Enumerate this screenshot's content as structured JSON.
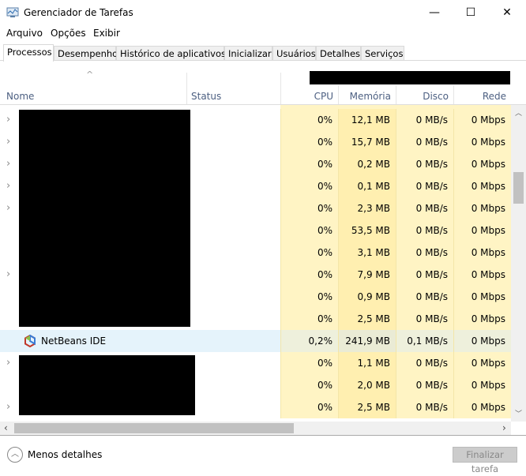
{
  "window": {
    "title": "Gerenciador de Tarefas",
    "minimize": "—",
    "maximize": "☐",
    "close": "✕"
  },
  "menu": [
    "Arquivo",
    "Opções",
    "Exibir"
  ],
  "tabs": [
    "Processos",
    "Desempenho",
    "Histórico de aplicativos",
    "Inicializar",
    "Usuários",
    "Detalhes",
    "Serviços"
  ],
  "columns": {
    "name": "Nome",
    "status": "Status",
    "cpu": "CPU",
    "memory": "Memória",
    "disk": "Disco",
    "network": "Rede"
  },
  "rows": [
    {
      "expand": true,
      "name": "",
      "cpu": "0%",
      "mem": "12,1 MB",
      "disk": "0 MB/s",
      "net": "0 Mbps"
    },
    {
      "expand": true,
      "name": "",
      "cpu": "0%",
      "mem": "15,7 MB",
      "disk": "0 MB/s",
      "net": "0 Mbps"
    },
    {
      "expand": true,
      "name": "",
      "cpu": "0%",
      "mem": "0,2 MB",
      "disk": "0 MB/s",
      "net": "0 Mbps"
    },
    {
      "expand": true,
      "name": "",
      "cpu": "0%",
      "mem": "0,1 MB",
      "disk": "0 MB/s",
      "net": "0 Mbps"
    },
    {
      "expand": true,
      "name": "",
      "cpu": "0%",
      "mem": "2,3 MB",
      "disk": "0 MB/s",
      "net": "0 Mbps"
    },
    {
      "expand": false,
      "name": "",
      "cpu": "0%",
      "mem": "53,5 MB",
      "disk": "0 MB/s",
      "net": "0 Mbps"
    },
    {
      "expand": false,
      "name": "",
      "cpu": "0%",
      "mem": "3,1 MB",
      "disk": "0 MB/s",
      "net": "0 Mbps"
    },
    {
      "expand": true,
      "name": "",
      "cpu": "0%",
      "mem": "7,9 MB",
      "disk": "0 MB/s",
      "net": "0 Mbps"
    },
    {
      "expand": false,
      "name": "",
      "cpu": "0%",
      "mem": "0,9 MB",
      "disk": "0 MB/s",
      "net": "0 Mbps"
    },
    {
      "expand": false,
      "name": "",
      "cpu": "0%",
      "mem": "2,5 MB",
      "disk": "0 MB/s",
      "net": "0 Mbps"
    },
    {
      "expand": false,
      "name": "NetBeans IDE",
      "selected": true,
      "cpu": "0,2%",
      "mem": "241,9 MB",
      "disk": "0,1 MB/s",
      "net": "0 Mbps"
    },
    {
      "expand": true,
      "name": "",
      "cpu": "0%",
      "mem": "1,1 MB",
      "disk": "0 MB/s",
      "net": "0 Mbps"
    },
    {
      "expand": false,
      "name": "",
      "cpu": "0%",
      "mem": "2,0 MB",
      "disk": "0 MB/s",
      "net": "0 Mbps"
    },
    {
      "expand": true,
      "name": "",
      "cpu": "0%",
      "mem": "2,5 MB",
      "disk": "0 MB/s",
      "net": "0 Mbps"
    }
  ],
  "footer": {
    "less_details": "Menos detalhes",
    "end_task": "Finalizar tarefa"
  }
}
